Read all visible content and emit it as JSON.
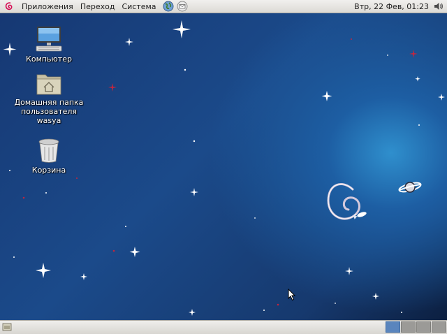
{
  "top_panel": {
    "menus": [
      "Приложения",
      "Переход",
      "Система"
    ],
    "clock": "Втр, 22 Фев, 01:23",
    "launcher_icons": [
      "browser-icon",
      "mail-icon"
    ],
    "tray_icons": [
      "volume-icon"
    ]
  },
  "desktop": {
    "icons": [
      {
        "name": "computer-icon",
        "label": "Компьютер"
      },
      {
        "name": "home-folder-icon",
        "label": "Домашняя папка пользователя wasya"
      },
      {
        "name": "trash-icon",
        "label": "Корзина"
      }
    ],
    "wallpaper_logo": "debian-swirl"
  },
  "bottom_panel": {
    "workspaces": 4,
    "active_workspace": 1
  },
  "colors": {
    "panel_bg": "#e6e4e0",
    "desktop_dark": "#0f2a55",
    "desktop_glow": "#2f8fcd",
    "debian_red": "#d70a53",
    "active_workspace": "#5a85bd"
  }
}
